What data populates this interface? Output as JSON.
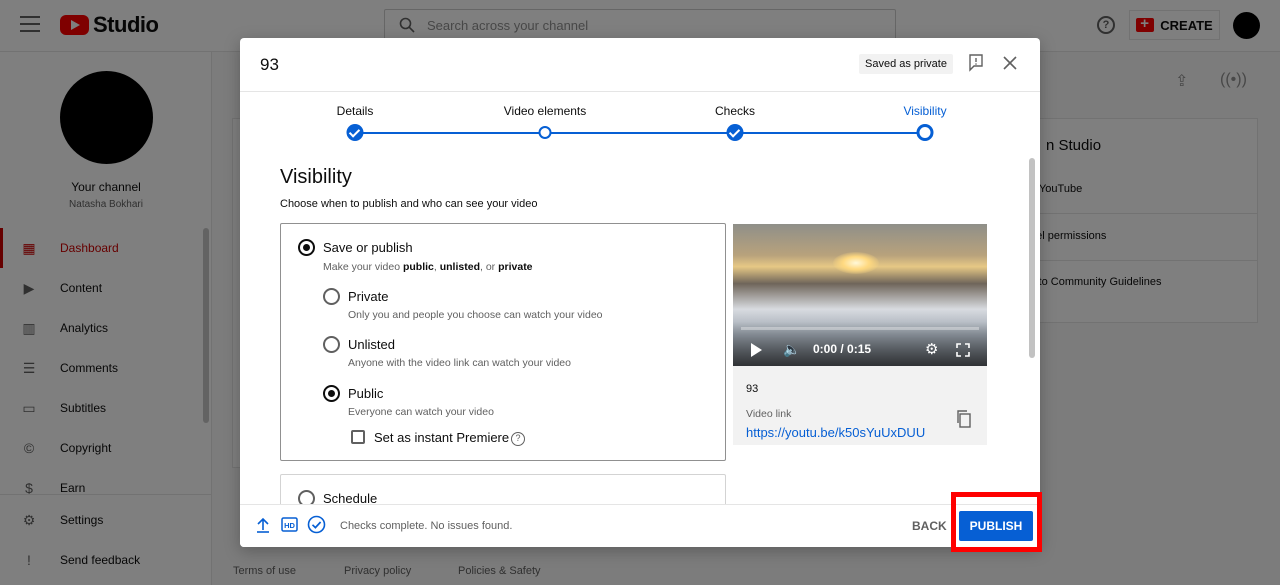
{
  "header": {
    "logo_text": "Studio",
    "search_placeholder": "Search across your channel",
    "help_icon": "help-icon",
    "create_label": "CREATE"
  },
  "sidebar": {
    "channel_title": "Your channel",
    "channel_name": "Natasha Bokhari",
    "items": [
      {
        "label": "Dashboard",
        "icon": "dashboard-icon",
        "glyph": "▦",
        "active": true
      },
      {
        "label": "Content",
        "icon": "content-icon",
        "glyph": "▶",
        "active": false
      },
      {
        "label": "Analytics",
        "icon": "analytics-icon",
        "glyph": "▥",
        "active": false
      },
      {
        "label": "Comments",
        "icon": "comments-icon",
        "glyph": "☰",
        "active": false
      },
      {
        "label": "Subtitles",
        "icon": "subtitles-icon",
        "glyph": "▭",
        "active": false
      },
      {
        "label": "Copyright",
        "icon": "copyright-icon",
        "glyph": "©",
        "active": false
      },
      {
        "label": "Earn",
        "icon": "earn-icon",
        "glyph": "$",
        "active": false
      }
    ],
    "bottom_items": [
      {
        "label": "Settings",
        "icon": "settings-icon",
        "glyph": "⚙"
      },
      {
        "label": "Send feedback",
        "icon": "feedback-icon",
        "glyph": "!"
      }
    ]
  },
  "background": {
    "card_title": "n Studio",
    "card_lines": [
      "n YouTube",
      "nel permissions",
      "s to Community Guidelines"
    ],
    "footer_links": [
      "Terms of use",
      "Privacy policy",
      "Policies & Safety"
    ]
  },
  "dialog": {
    "title": "93",
    "saved_chip": "Saved as private",
    "steps": [
      {
        "label": "Details",
        "state": "done"
      },
      {
        "label": "Video elements",
        "state": "partial"
      },
      {
        "label": "Checks",
        "state": "done"
      },
      {
        "label": "Visibility",
        "state": "current"
      }
    ],
    "visibility_heading": "Visibility",
    "visibility_subtitle": "Choose when to publish and who can see your video",
    "save_publish": {
      "label": "Save or publish",
      "desc_prefix": "Make your video ",
      "desc_public": "public",
      "desc_sep1": ", ",
      "desc_unlisted": "unlisted",
      "desc_sep2": ", or ",
      "desc_private": "private",
      "selected": true
    },
    "options": [
      {
        "label": "Private",
        "desc": "Only you and people you choose can watch your video",
        "selected": false
      },
      {
        "label": "Unlisted",
        "desc": "Anyone with the video link can watch your video",
        "selected": false
      },
      {
        "label": "Public",
        "desc": "Everyone can watch your video",
        "selected": true
      }
    ],
    "premiere_label": "Set as instant Premiere",
    "premiere_checked": false,
    "schedule_label": "Schedule",
    "preview": {
      "time": "0:00 / 0:15",
      "title": "93",
      "link_caption": "Video link",
      "link": "https://youtu.be/k50sYuUxDUU"
    },
    "footer": {
      "status": "Checks complete. No issues found.",
      "back_label": "BACK",
      "publish_label": "PUBLISH"
    }
  }
}
